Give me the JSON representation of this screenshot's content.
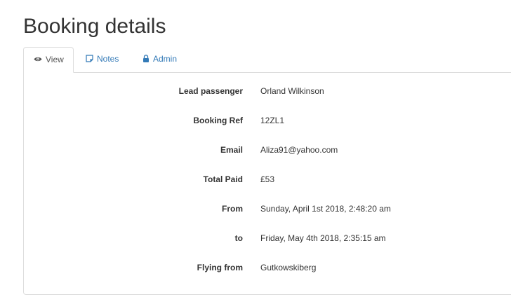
{
  "page": {
    "title": "Booking details"
  },
  "tabs": [
    {
      "label": "View",
      "icon": "eye-icon",
      "active": true
    },
    {
      "label": "Notes",
      "icon": "note-icon",
      "active": false
    },
    {
      "label": "Admin",
      "icon": "lock-icon",
      "active": false
    }
  ],
  "details": [
    {
      "label": "Lead passenger",
      "value": "Orland Wilkinson"
    },
    {
      "label": "Booking Ref",
      "value": "12ZL1"
    },
    {
      "label": "Email",
      "value": "Aliza91@yahoo.com"
    },
    {
      "label": "Total Paid",
      "value": "£53"
    },
    {
      "label": "From",
      "value": "Sunday, April 1st 2018, 2:48:20 am"
    },
    {
      "label": "to",
      "value": "Friday, May 4th 2018, 2:35:15 am"
    },
    {
      "label": "Flying from",
      "value": "Gutkowskiberg"
    }
  ],
  "colors": {
    "link": "#337ab7",
    "border": "#dddddd",
    "text": "#333333"
  }
}
